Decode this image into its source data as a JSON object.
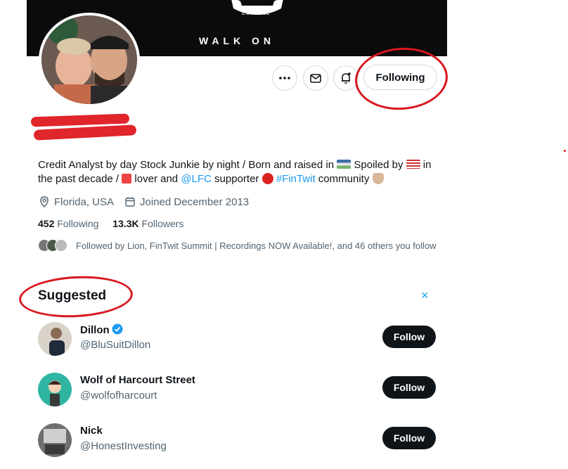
{
  "banner": {
    "crest_text": "EST·1892",
    "tagline": "WALK ON"
  },
  "actions": {
    "following_label": "Following"
  },
  "bio": {
    "part1": "Credit Analyst by day Stock Junkie by night / Born and raised in ",
    "part2": " Spoiled by ",
    "part3": " in the past decade / ",
    "part4": " lover and ",
    "mention": "@LFC",
    "part5": " supporter ",
    "hashtag": "#FinTwit",
    "part6": " community "
  },
  "meta": {
    "location": "Florida, USA",
    "joined": "Joined December 2013"
  },
  "counts": {
    "following_num": "452",
    "following_label": " Following",
    "followers_num": "13.3K",
    "followers_label": " Followers"
  },
  "followed_by": "Followed by Lion, FinTwit Summit | Recordings NOW Available!, and 46 others you follow",
  "suggested": {
    "title": "Suggested",
    "close": "×",
    "users": [
      {
        "name": "Dillon",
        "handle": "@BluSuitDillon",
        "button": "Follow",
        "verified": true
      },
      {
        "name": "Wolf of Harcourt Street",
        "handle": "@wolfofharcourt",
        "button": "Follow",
        "verified": false
      },
      {
        "name": "Nick",
        "handle": "@HonestInvesting",
        "button": "Follow",
        "verified": false
      }
    ]
  },
  "colors": {
    "accent": "#1d9bf0",
    "annotation_red": "#d8171d",
    "button_dark": "#0f1419"
  }
}
